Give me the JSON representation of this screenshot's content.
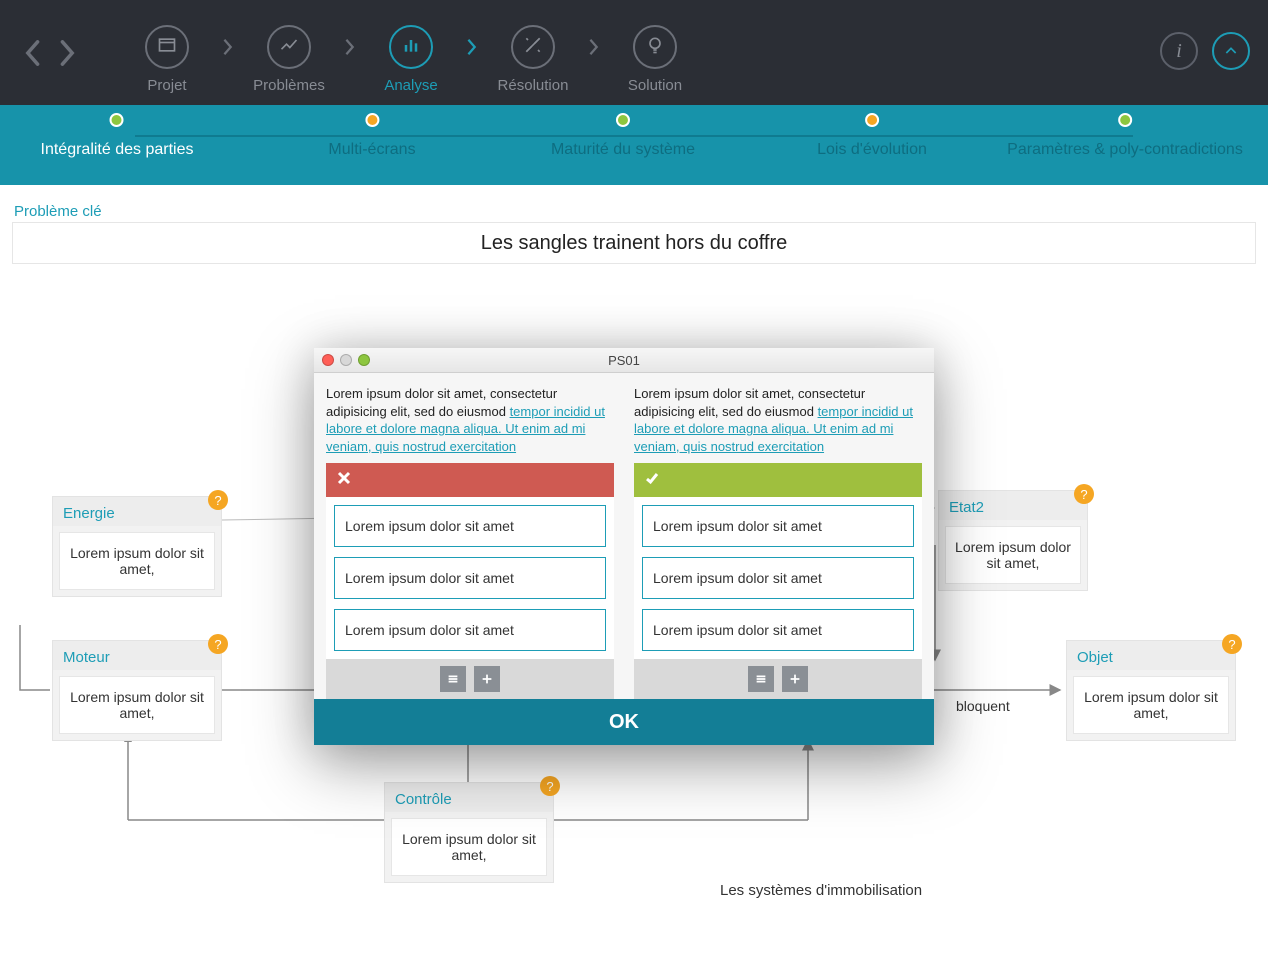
{
  "breadcrumb": [
    {
      "label": "Projet"
    },
    {
      "label": "Problèmes"
    },
    {
      "label": "Analyse"
    },
    {
      "label": "Résolution"
    },
    {
      "label": "Solution"
    }
  ],
  "subnav": [
    {
      "label": "Intégralité des parties",
      "color": "green",
      "active": true
    },
    {
      "label": "Multi-écrans",
      "color": "orange"
    },
    {
      "label": "Maturité du système",
      "color": "green"
    },
    {
      "label": "Lois d'évolution",
      "color": "orange"
    },
    {
      "label": "Paramètres & poly-contradictions",
      "color": "green"
    }
  ],
  "problem": {
    "title": "Problème clé",
    "value": "Les sangles trainent hors du coffre"
  },
  "nodes": {
    "energie": {
      "title": "Energie",
      "body": "Lorem ipsum dolor sit amet,"
    },
    "moteur": {
      "title": "Moteur",
      "body": "Lorem ipsum dolor sit amet,"
    },
    "etat2": {
      "title": "Etat2",
      "body": "Lorem ipsum dolor sit amet,"
    },
    "objet": {
      "title": "Objet",
      "body": "Lorem ipsum dolor sit amet,"
    },
    "controle": {
      "title": "Contrôle",
      "body": "Lorem ipsum dolor sit amet,"
    }
  },
  "edge_label": "bloquent",
  "footer_label": "Les systèmes d'immobilisation",
  "modal": {
    "title": "PS01",
    "ok": "OK",
    "text_plain": "Lorem ipsum dolor sit amet, consectetur adipisicing elit, sed do eiusmod ",
    "text_link": "tempor incidid ut labore et dolore magna aliqua. Ut enim ad mi veniam, quis nostrud exercitation ",
    "items": [
      "Lorem ipsum dolor sit amet",
      "Lorem ipsum dolor sit amet",
      "Lorem ipsum dolor sit amet"
    ]
  }
}
